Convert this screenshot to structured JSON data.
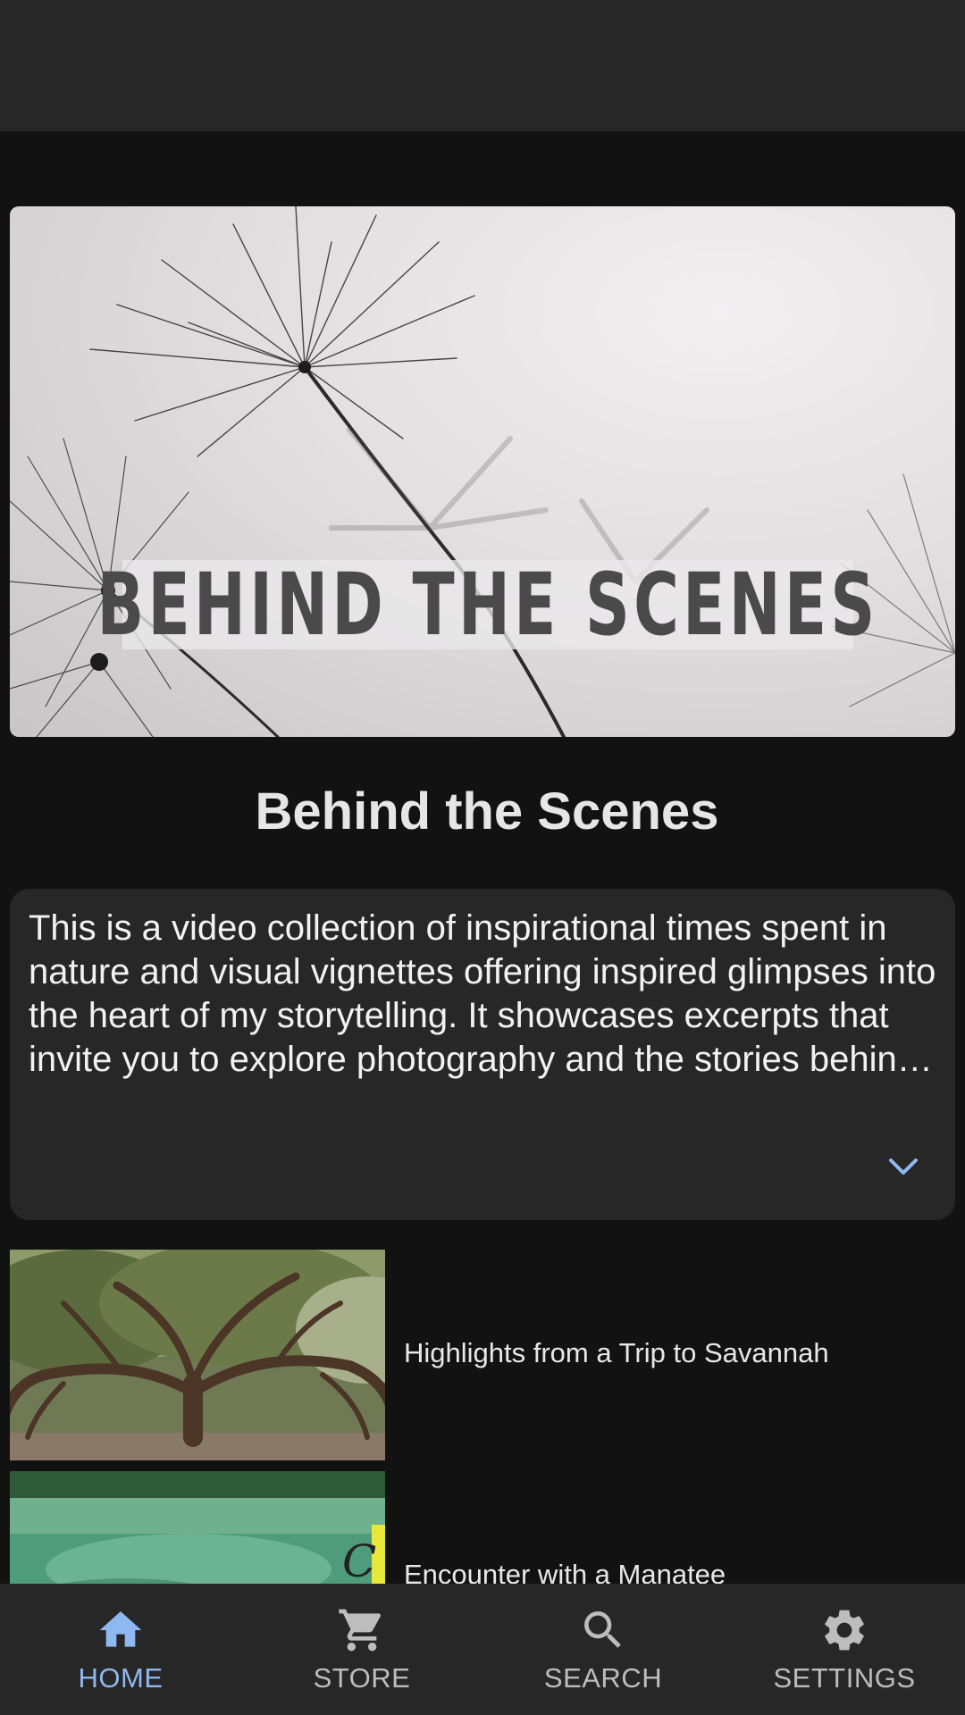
{
  "album": {
    "hero_text": "BEHIND THE SCENES",
    "title": "Behind the Scenes",
    "description": "This is a video collection of inspirational times spent in nature and visual vignettes offering inspired glimpses into the heart of my storytelling. It showcases excerpts that invite you to explore photography and the stories behind them.",
    "expand_icon": "chevron-down-icon"
  },
  "videos": [
    {
      "title": "Highlights from a Trip to Savannah",
      "thumbnail": "live-oak-tree"
    },
    {
      "title": "Encounter with a Manatee",
      "thumbnail": "manatee-spring"
    }
  ],
  "nav": {
    "items": [
      {
        "label": "HOME",
        "icon": "home-icon",
        "active": true
      },
      {
        "label": "STORE",
        "icon": "cart-icon",
        "active": false
      },
      {
        "label": "SEARCH",
        "icon": "search-icon",
        "active": false
      },
      {
        "label": "SETTINGS",
        "icon": "gear-icon",
        "active": false
      }
    ]
  },
  "colors": {
    "background": "#121212",
    "surface": "#272727",
    "accent": "#8fb8f0",
    "nav_inactive": "#bdbdbd"
  }
}
